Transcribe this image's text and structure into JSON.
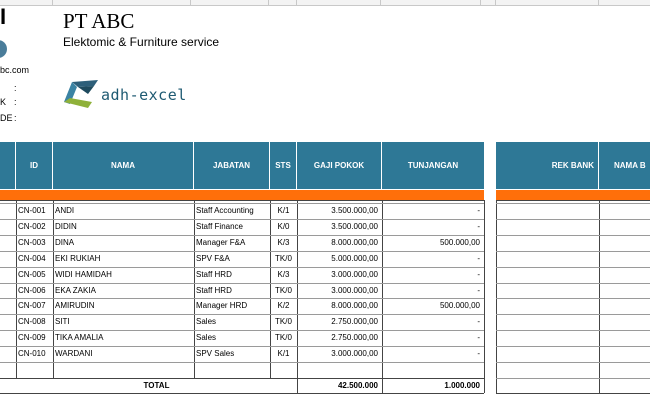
{
  "header": {
    "company_name": "PT ABC",
    "tagline": "Elektomic & Furniture service",
    "partial_left_glyph": "I",
    "partial_web": "bc.com",
    "partial_field_1": "K",
    "partial_field_2": "DE",
    "colon": ":"
  },
  "logo": {
    "text": "adh-excel"
  },
  "table": {
    "columns": [
      "ID",
      "NAMA",
      "JABATAN",
      "STS",
      "GAJI POKOK",
      "TUNJANGAN"
    ],
    "rows": [
      {
        "id": "CN-001",
        "nama": "ANDI",
        "jabatan": "Staff Accounting",
        "sts": "K/1",
        "gaji": "3.500.000,00",
        "tunjangan": "-"
      },
      {
        "id": "CN-002",
        "nama": "DIDIN",
        "jabatan": "Staff Finance",
        "sts": "K/0",
        "gaji": "3.500.000,00",
        "tunjangan": "-"
      },
      {
        "id": "CN-003",
        "nama": "DINA",
        "jabatan": "Manager F&A",
        "sts": "K/3",
        "gaji": "8.000.000,00",
        "tunjangan": "500.000,00"
      },
      {
        "id": "CN-004",
        "nama": "EKI RUKIAH",
        "jabatan": "SPV F&A",
        "sts": "TK/0",
        "gaji": "5.000.000,00",
        "tunjangan": "-"
      },
      {
        "id": "CN-005",
        "nama": "WIDI HAMIDAH",
        "jabatan": "Staff HRD",
        "sts": "K/3",
        "gaji": "3.000.000,00",
        "tunjangan": "-"
      },
      {
        "id": "CN-006",
        "nama": "EKA ZAKIA",
        "jabatan": "Staff HRD",
        "sts": "TK/0",
        "gaji": "3.000.000,00",
        "tunjangan": "-"
      },
      {
        "id": "CN-007",
        "nama": "AMIRUDIN",
        "jabatan": "Manager HRD",
        "sts": "K/2",
        "gaji": "8.000.000,00",
        "tunjangan": "500.000,00"
      },
      {
        "id": "CN-008",
        "nama": "SITI",
        "jabatan": "Sales",
        "sts": "TK/0",
        "gaji": "2.750.000,00",
        "tunjangan": "-"
      },
      {
        "id": "CN-009",
        "nama": "TIKA AMALIA",
        "jabatan": "Sales",
        "sts": "TK/0",
        "gaji": "2.750.000,00",
        "tunjangan": "-"
      },
      {
        "id": "CN-010",
        "nama": "WARDANI",
        "jabatan": "SPV Sales",
        "sts": "K/1",
        "gaji": "3.000.000,00",
        "tunjangan": "-"
      }
    ],
    "total_label": "TOTAL",
    "total_gaji": "42.500.000",
    "total_tunjangan": "1.000.000"
  },
  "bank_table": {
    "columns": [
      "REK BANK",
      "NAMA B"
    ]
  },
  "colors": {
    "header_blue": "#2e7896",
    "accent_orange": "#ff6f0a"
  }
}
